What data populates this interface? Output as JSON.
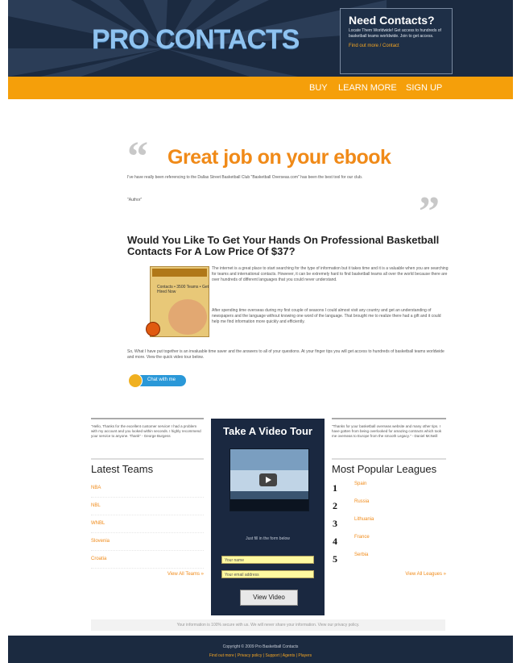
{
  "header": {
    "logo_text": "PRO CONTACTS",
    "need_title": "Need Contacts?",
    "need_desc": "Locate Them Worldwide! Get access to hundreds of basketball teams worldwide. Join to get access.",
    "need_link": "Find out more / Contact"
  },
  "nav": {
    "buy": "BUY",
    "learn": "LEARN MORE",
    "signup": "SIGN UP"
  },
  "hero": {
    "headline": "Great  job on your ebook",
    "testimonial": "I've have really been referencing to the Dallas Street Basketball Club \"Basketball Overseas.com\" has been the best tool for our club.",
    "author": "\"Author\""
  },
  "pitch": {
    "question": "Would You Like To Get Your Hands On Professional Basketball Contacts For A Low Price Of $37?",
    "book_title": "Basketball Overseas",
    "book_text": "Contacts • 3500 Teams • Get Hired Now",
    "para1": "The internet is a great place to start searching for the type of information but it takes time and it is a valuable when you are searching for teams and international contacts. However, it can be extremely hard to find basketball teams all over the world because there are over hundreds of different languages that you could never understand.",
    "para2": "After spending time overseas during my first couple of seasons I could almost visit any country and get an understanding of newspapers and the language without knowing one word of the language. That brought me to realize there had a gift and it could help me find information more quickly and efficiently.",
    "para3": "So, What I have put together is an invaluable time saver and the answers to all of your questions. At your finger tips you will get access to hundreds of basketball teams worldwide and more. View the quick video tour below.",
    "chat_label": "Chat with me"
  },
  "left_col": {
    "quote": "\"Hello, Thanks for the excellent customer service! I had a problem with my account and you looked within seconds. I highly recommend your service to anyone. Thank\" - George Burgess",
    "title": "Latest Teams",
    "teams": [
      "NBA",
      "NBL",
      "WNBL",
      "Slovenia",
      "Croatia"
    ],
    "view_all": "View All Teams »"
  },
  "video": {
    "title": "Take A Video Tour",
    "caption": "Just fill in the form below",
    "name_placeholder": "Your name",
    "email_placeholder": "Your email address",
    "button": "View Video"
  },
  "right_col": {
    "quote": "\"Thanks for your basketball overseas website and many other tips. I have gotten from being overlooked for amazing contracts which took me overseas to Europe from the smooth Legacy.\" - Daniel McNeill",
    "title": "Most Popular Leagues",
    "leagues": [
      {
        "num": "1",
        "name": "Spain"
      },
      {
        "num": "2",
        "name": "Russia"
      },
      {
        "num": "3",
        "name": "Lithuania"
      },
      {
        "num": "4",
        "name": "France"
      },
      {
        "num": "5",
        "name": "Serbia"
      }
    ],
    "view_all": "View All Leagues »"
  },
  "privacy_note": "Your information is 100% secure with us. We will never share your information. View our privacy policy.",
  "footer": {
    "copyright": "Copyright © 2009 Pro Basketball Contacts",
    "links": "Find out more | Privacy policy | Support | Agents | Players"
  },
  "colors": {
    "navy": "#1b2a40",
    "orange": "#f59f0a",
    "accent": "#f08a18"
  }
}
